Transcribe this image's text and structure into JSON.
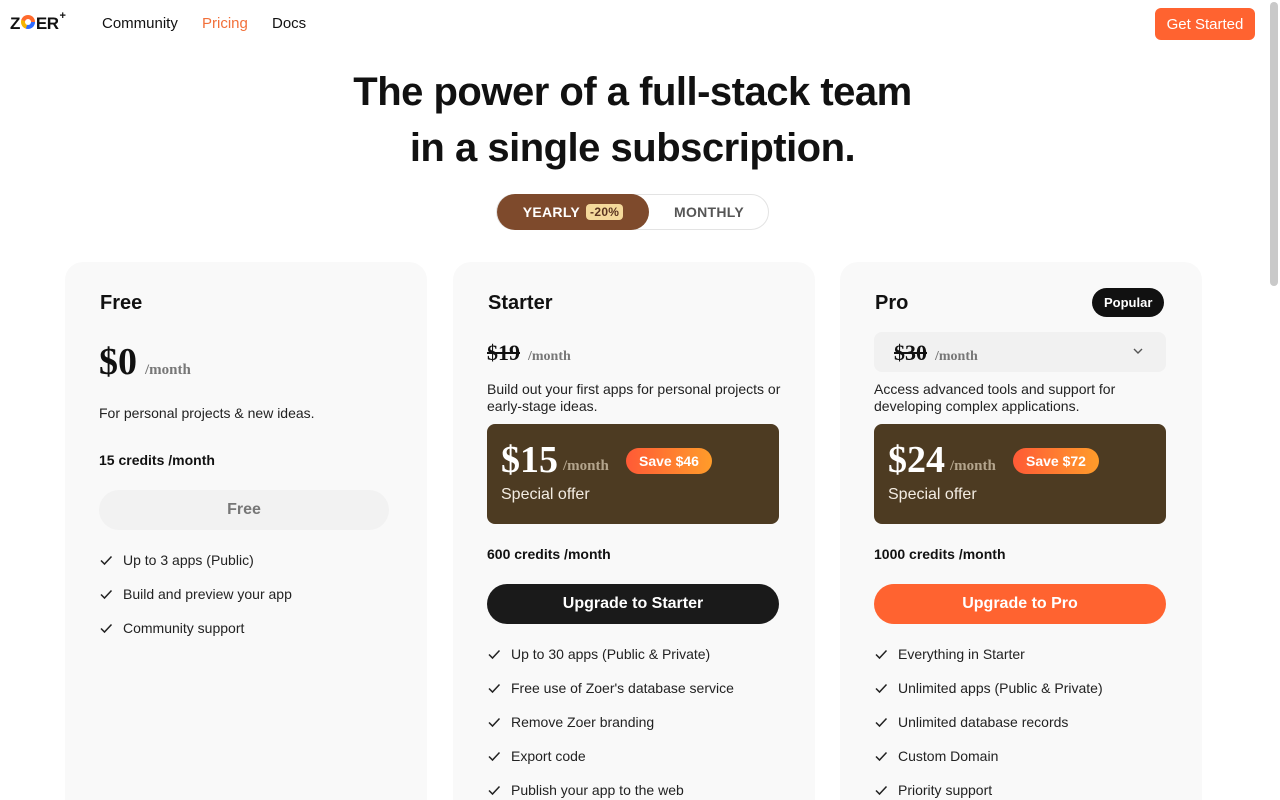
{
  "nav": {
    "logo_text": "ZOER",
    "logo_plus": "+",
    "links": [
      "Community",
      "Pricing",
      "Docs"
    ],
    "active_link": "Pricing",
    "cta": "Get Started"
  },
  "hero": {
    "line1": "The power of a full-stack team",
    "line2": "in a single subscription."
  },
  "billing_toggle": {
    "yearly": "YEARLY",
    "discount": "-20%",
    "monthly": "MONTHLY",
    "selected": "YEARLY"
  },
  "plans": [
    {
      "name": "Free",
      "price": "$0",
      "per": "/month",
      "description": "For personal projects & new ideas.",
      "credits": "15 credits /month",
      "button": "Free",
      "features": [
        "Up to 3 apps (Public)",
        "Build and preview your app",
        "Community support"
      ]
    },
    {
      "name": "Starter",
      "original_price": "$19",
      "per": "/month",
      "description": "Build out your first apps for personal projects or early-stage ideas.",
      "offer_price": "$15",
      "offer_per": "/month",
      "save": "Save $46",
      "offer_label": "Special offer",
      "credits": "600 credits /month",
      "button": "Upgrade to Starter",
      "features": [
        "Up to 30 apps (Public & Private)",
        "Free use of Zoer's database service",
        "Remove Zoer branding",
        "Export code",
        "Publish your app to the web"
      ]
    },
    {
      "name": "Pro",
      "badge": "Popular",
      "original_price": "$30",
      "per": "/month",
      "description": "Access advanced tools and support for developing complex applications.",
      "offer_price": "$24",
      "offer_per": "/month",
      "save": "Save $72",
      "offer_label": "Special offer",
      "credits": "1000 credits /month",
      "button": "Upgrade to Pro",
      "features": [
        "Everything in Starter",
        "Unlimited apps (Public & Private)",
        "Unlimited database records",
        "Custom Domain",
        "Priority support"
      ]
    }
  ],
  "colors": {
    "accent": "#ff6330",
    "toggle_active": "#7e4a2c",
    "offer_bg": "#4d3b22",
    "card_bg": "#f9f9f9"
  },
  "icons": {
    "feature": "check-icon",
    "pro_dropdown": "chevron-down-icon"
  }
}
